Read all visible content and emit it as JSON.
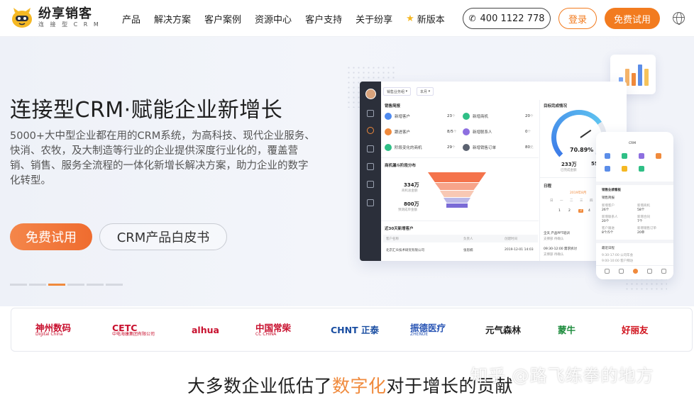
{
  "nav": {
    "logo_name": "纷享销客",
    "logo_sub": "连 接 型 C R M",
    "menu": [
      "产品",
      "解决方案",
      "客户案例",
      "资源中心",
      "客户支持",
      "关于纷享"
    ],
    "new_version": "新版本",
    "phone": "400 1122 778",
    "login": "登录",
    "trial": "免费试用"
  },
  "hero": {
    "title": "连接型CRM·赋能企业新增长",
    "description": "5000+大中型企业都在用的CRM系统，为高科技、现代企业服务、快消、农牧，及大制造等行业的企业提供深度行业化的，覆盖营销、销售、服务全流程的一体化新增长解决方案，助力企业的数字化转型。",
    "primary_button": "免费试用",
    "secondary_button": "CRM产品白皮书",
    "carousel": {
      "count": 6,
      "active_index": 2
    }
  },
  "dashboard": {
    "filter_1": "销售业务组",
    "filter_2": "本月",
    "sales_brief": "销售简报",
    "kpis": [
      {
        "label": "新增客户",
        "value": "23",
        "unit": "个",
        "color": "#4e8af0"
      },
      {
        "label": "新增商机",
        "value": "20",
        "unit": "个",
        "color": "#2fbf86"
      },
      {
        "label": "跟进客户",
        "value": "8/5",
        "unit": "个",
        "color": "#f08a3c"
      },
      {
        "label": "新增联系人",
        "value": "0",
        "unit": "个",
        "color": "#8d6fe0"
      },
      {
        "label": "阶段变化的商机",
        "value": "29",
        "unit": "个",
        "color": "#2fbf86"
      },
      {
        "label": "新增销售订单",
        "value": "80",
        "unit": "元",
        "color": "#5b6270"
      }
    ],
    "funnel_title": "商机漏斗阶段分布",
    "funnel_amount_1": "334万",
    "funnel_label_1": "商机总金额",
    "funnel_amount_2": "800万",
    "funnel_label_2": "预测成单金额",
    "recent_title": "近30天新增客户",
    "table_headers": [
      "客户名称",
      "负责人",
      "创建时间"
    ],
    "table_row": [
      "北京汇众技术研究有限公司",
      "张思楠",
      "2019-12-01 14:03"
    ],
    "goal_title": "目标完成情况",
    "goal_percent": "70.89%",
    "goal_done": "233万",
    "goal_done_label": "已完成金额",
    "goal_target": "55",
    "calendar_title": "日程",
    "calendar_month": "2019年8月",
    "weekdays": [
      "日",
      "一",
      "二",
      "三",
      "四",
      "五",
      "六"
    ],
    "days": [
      "1",
      "2",
      "3",
      "4",
      "5",
      "6"
    ],
    "event1": "全天  产品PPT培训",
    "event1_sub": "支撑部  待确认",
    "event2": "09:30-12:00  需求拆讨",
    "event2_sub": "支撑部  待确认"
  },
  "mini_chart": {
    "values": [
      2,
      4,
      3,
      5,
      4
    ],
    "colors": [
      "#7aa6f5",
      "#f5b46a",
      "#f08a3c",
      "#5b8de8",
      "#f6c35a"
    ]
  },
  "phone": {
    "title": "CRM",
    "section": "销售业绩看板",
    "sub_section": "销售简报",
    "metrics": [
      {
        "label": "新增客户",
        "value": "26个"
      },
      {
        "label": "新增商机",
        "value": "58个"
      },
      {
        "label": "新增联系人",
        "value": "20个"
      },
      {
        "label": "新增合同",
        "value": "7个"
      },
      {
        "label": "客户跟进",
        "value": "8个/5个"
      },
      {
        "label": "新增销售订单",
        "value": "20单"
      }
    ],
    "schedule": "最近日程",
    "item1": "9:30-17:00 公司年会",
    "item2": "9:00-10:00 客户拜访"
  },
  "brands": [
    {
      "name": "神州数码",
      "sub": "Digital China",
      "color": "#c8102e"
    },
    {
      "name": "CETC",
      "sub": "中电海康集团有限公司",
      "color": "#c8102e"
    },
    {
      "name": "alhua",
      "sub": "",
      "color": "#c8102e"
    },
    {
      "name": "中国常柴",
      "sub": "CC CHINA",
      "color": "#c8102e"
    },
    {
      "name": "CHNT 正泰",
      "sub": "",
      "color": "#1a4ea2"
    },
    {
      "name": "振德医疗",
      "sub": "ZHENDE",
      "color": "#2a56b5"
    },
    {
      "name": "元气森林",
      "sub": "",
      "color": "#222222"
    },
    {
      "name": "蒙牛",
      "sub": "",
      "color": "#1a8a3a"
    },
    {
      "name": "好丽友",
      "sub": "",
      "color": "#d0101b"
    }
  ],
  "tagline": {
    "before": "大多数企业低估了",
    "highlight": "数字化",
    "after": "对于增长的贡献"
  },
  "watermark": "知乎 @路飞练拳的地方"
}
